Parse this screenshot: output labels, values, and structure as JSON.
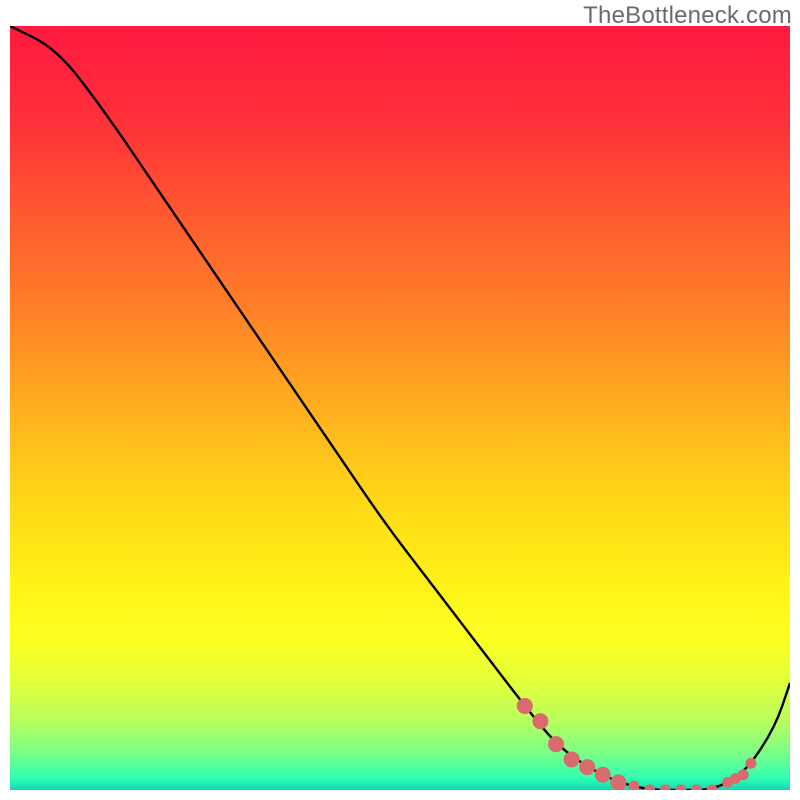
{
  "attribution": "TheBottleneck.com",
  "chart_data": {
    "type": "line",
    "title": "",
    "xlabel": "",
    "ylabel": "",
    "xlim": [
      0,
      100
    ],
    "ylim": [
      0,
      100
    ],
    "series": [
      {
        "name": "bottleneck-curve",
        "x": [
          0,
          6,
          12,
          18,
          24,
          30,
          36,
          42,
          48,
          54,
          60,
          66,
          70,
          74,
          78,
          82,
          86,
          90,
          94,
          98,
          100
        ],
        "y": [
          100,
          97,
          89,
          80,
          71,
          62,
          53,
          44,
          35,
          27,
          19,
          11,
          6,
          3,
          1,
          0,
          0,
          0,
          2,
          8,
          14
        ]
      }
    ],
    "markers": {
      "name": "highlight-points",
      "x": [
        66,
        68,
        70,
        72,
        74,
        76,
        78,
        80,
        82,
        84,
        86,
        88,
        90,
        92,
        93,
        94,
        95
      ],
      "y": [
        11,
        9,
        6,
        4,
        3,
        2,
        1,
        0.5,
        0,
        0,
        0,
        0,
        0,
        1,
        1.5,
        2,
        3.5
      ],
      "large_indices": [
        0,
        1,
        2,
        3,
        4,
        5,
        6
      ]
    },
    "gradient_stops": [
      {
        "offset": 0.0,
        "color": "#ff193f"
      },
      {
        "offset": 0.12,
        "color": "#ff2f3a"
      },
      {
        "offset": 0.25,
        "color": "#ff5a30"
      },
      {
        "offset": 0.38,
        "color": "#ff8327"
      },
      {
        "offset": 0.5,
        "color": "#ffaf1f"
      },
      {
        "offset": 0.62,
        "color": "#ffd718"
      },
      {
        "offset": 0.72,
        "color": "#fff016"
      },
      {
        "offset": 0.8,
        "color": "#fdff20"
      },
      {
        "offset": 0.86,
        "color": "#e2ff3b"
      },
      {
        "offset": 0.91,
        "color": "#b7ff5e"
      },
      {
        "offset": 0.95,
        "color": "#7dff86"
      },
      {
        "offset": 0.985,
        "color": "#2effb1"
      },
      {
        "offset": 1.0,
        "color": "#0fd8b4"
      }
    ],
    "marker_color": "#d96a6e",
    "line_color": "#000000"
  }
}
